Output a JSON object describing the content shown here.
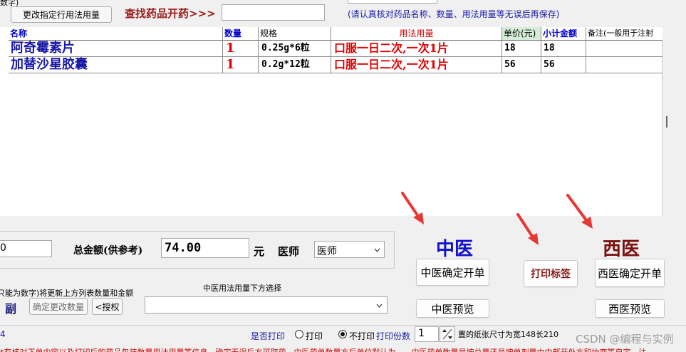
{
  "top": {
    "corner_fragment": "数字)",
    "edit_usage_button": "更改指定行用法用量",
    "find_drug_label": "查找药品开药>>>",
    "search_value": "",
    "notice": "(请认真核对药品名称、数量、用法用量等无误后再保存)"
  },
  "table": {
    "headers": [
      "名称",
      "数量",
      "规格",
      "用法用量",
      "单价(元)",
      "小计金额",
      "备注(一般用于注射"
    ],
    "rows": [
      {
        "name": "阿奇霉素片",
        "qty": "1",
        "spec": "0.25g*6粒",
        "usage": "口服一日二次,一次1片",
        "price": "18",
        "subtotal": "18",
        "note": ""
      },
      {
        "name": "加替沙星胶囊",
        "qty": "1",
        "spec": "0.2g*12粒",
        "usage": "口服一日二次,一次1片",
        "price": "56",
        "subtotal": "56",
        "note": ""
      }
    ]
  },
  "summary": {
    "left_value": "0",
    "total_label": "总金额(供参考)",
    "total_value": "74.00",
    "unit": "元",
    "doctor_label": "医师",
    "doctor_value": "医师"
  },
  "qty_edit": {
    "hint": "只能为数字)将更新上方列表数量和金额",
    "fu_label": "副",
    "confirm_button": "确定更改数量",
    "auth_button": "<授权"
  },
  "tcm_usage": {
    "label": "中医用法用量下方选择",
    "value": ""
  },
  "tcm": {
    "title": "中医",
    "confirm_button": "中医确定开单",
    "preview_button": "中医预览"
  },
  "print_label_button": "打印标签",
  "western": {
    "title": "西医",
    "confirm_button": "西医确定开单",
    "preview_button": "西医预览"
  },
  "status": {
    "left_num": "4",
    "print_question": "是否打印",
    "print_option": "打印",
    "noprint_option": "不打印",
    "copies_label": "打印份数",
    "copies_value": "1",
    "paper_note": "置的纸张尺寸为宽148长210"
  },
  "footer_fragment": "*有核对下单内容以及打印后的药品包装数量用法用量等信息，确定无误后方可取药。中医药单数量方后单位默认为……中医药单数量是按总量还是按单剂量由中部开处方和协商等自定，注",
  "watermark": "CSDN @编程与实例",
  "colors": {
    "blue_header": "#0000c8",
    "red_text": "#e00000",
    "tcm_title": "#1010d0",
    "western_title": "#7a1010",
    "arrow": "#e53935"
  },
  "icons": [
    "dropdown-arrow-icon",
    "spin-up-down-icon",
    "annotation-arrow-icon"
  ]
}
